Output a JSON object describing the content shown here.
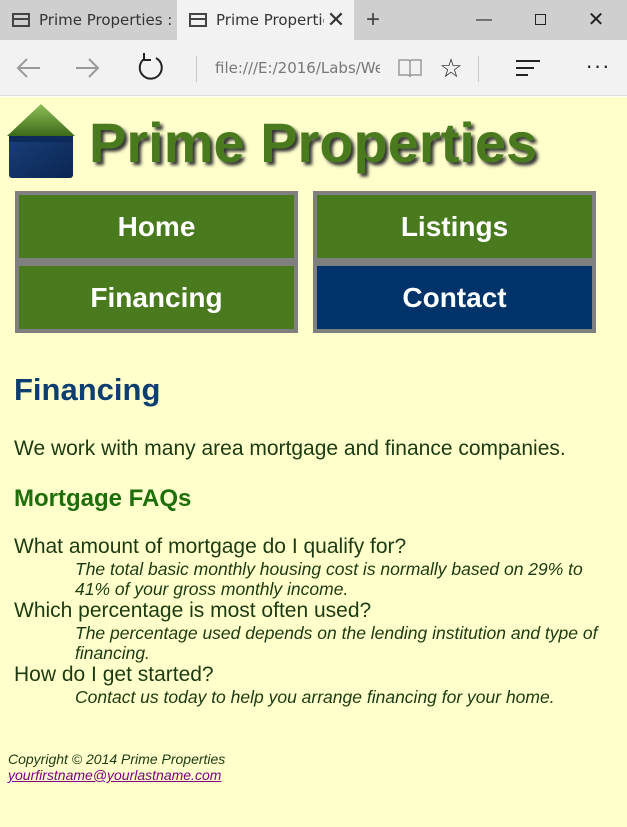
{
  "browser": {
    "tabs": [
      {
        "title": "Prime Properties :",
        "active": false
      },
      {
        "title": "Prime Properties :",
        "active": true
      }
    ],
    "address": "file:///E:/2016/Labs/We",
    "window_controls": {
      "minimize": "minimize-icon",
      "maximize": "maximize-icon",
      "close": "close-icon"
    }
  },
  "site": {
    "title": "Prime Properties",
    "colors": {
      "green": "#4a7a1e",
      "blue": "#00336a",
      "background": "#ffffcc"
    }
  },
  "menu": {
    "home": "Home",
    "listings": "Listings",
    "financing": "Financing",
    "contact": "Contact"
  },
  "main": {
    "heading": "Financing",
    "intro": "We work with many area mortgage and finance companies.",
    "faq_heading": "Mortgage FAQs",
    "faqs": [
      {
        "q": "What amount of mortgage do I qualify for?",
        "a": "The total basic monthly housing cost is normally based on 29% to 41% of your gross monthly income."
      },
      {
        "q": "Which percentage is most often used?",
        "a": "The percentage used depends on the lending institution and type of financing."
      },
      {
        "q": "How do I get started?",
        "a": "Contact us today to help you arrange financing for your home."
      }
    ]
  },
  "footer": {
    "copyright": "Copyright © 2014 Prime Properties",
    "email": "yourfirstname@yourlastname.com"
  }
}
